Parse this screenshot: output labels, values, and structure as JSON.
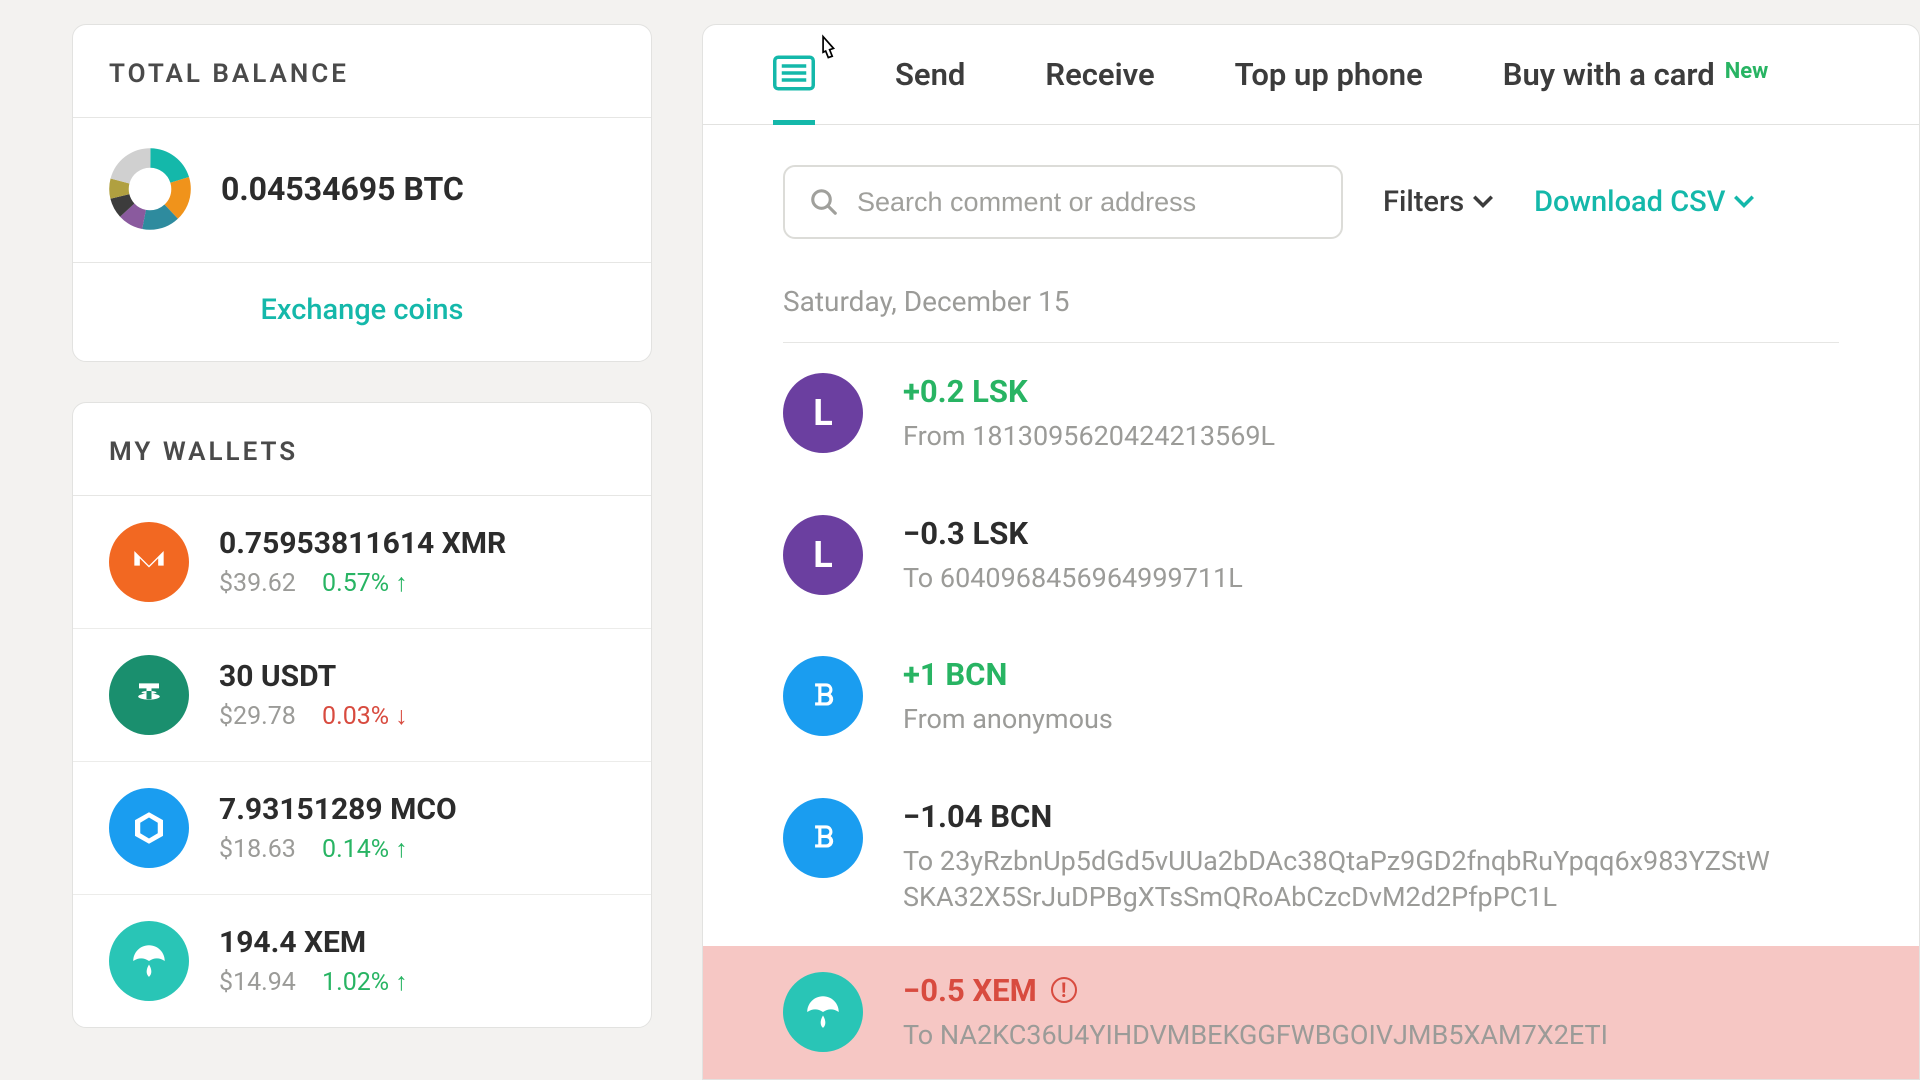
{
  "sidebar": {
    "balance_header": "TOTAL BALANCE",
    "balance_value": "0.04534695 BTC",
    "exchange_label": "Exchange coins",
    "wallets_header": "MY WALLETS",
    "wallets": [
      {
        "amount": "0.75953811614 XMR",
        "usd": "$39.62",
        "pct": "0.57% ↑",
        "dir": "up"
      },
      {
        "amount": "30 USDT",
        "usd": "$29.78",
        "pct": "0.03% ↓",
        "dir": "down"
      },
      {
        "amount": "7.93151289 MCO",
        "usd": "$18.63",
        "pct": "0.14% ↑",
        "dir": "up"
      },
      {
        "amount": "194.4 XEM",
        "usd": "$14.94",
        "pct": "1.02% ↑",
        "dir": "up"
      }
    ]
  },
  "tabs": {
    "send": "Send",
    "receive": "Receive",
    "topup": "Top up phone",
    "buy": "Buy with a card",
    "buy_badge": "New"
  },
  "toolbar": {
    "search_placeholder": "Search comment or address",
    "filters": "Filters",
    "download": "Download CSV"
  },
  "transactions": {
    "date": "Saturday, December 15",
    "rows": [
      {
        "amount": "+0.2 LSK",
        "detail": "From 1813095620424213569L"
      },
      {
        "amount": "−0.3 LSK",
        "detail": "To 6040968456964999711L"
      },
      {
        "amount": "+1 BCN",
        "detail": "From anonymous"
      },
      {
        "amount": "−1.04 BCN",
        "detail": "To 23yRzbnUp5dGd5vUUa2bDAc38QtaPz9GD2fnqbRuYpqq6x983YZStWSKA32X5SrJuDPBgXTsSmQRoAbCzcDvM2d2PfpPC1L"
      },
      {
        "amount": "−0.5 XEM",
        "detail": "To NA2KC36U4YIHDVMBEKGGFWBGOIVJMB5XAM7X2ETI"
      }
    ]
  }
}
